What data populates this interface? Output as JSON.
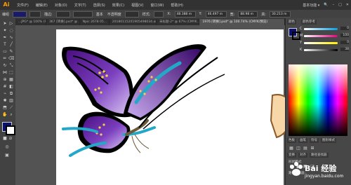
{
  "app": {
    "logo": "Ai"
  },
  "menu": {
    "items": [
      "文件(F)",
      "编辑(E)",
      "对象(O)",
      "文字(T)",
      "选择(S)",
      "效果(C)",
      "视图(V)",
      "窗口(W)",
      "帮助(H)"
    ],
    "right": [
      "基本功能 ▾",
      "🔍"
    ]
  },
  "options": {
    "group_label": "编组",
    "stroke_label": "描边:",
    "basic_label": "基本",
    "opacity_label": "不透明度",
    "style_label": "样式:",
    "x_value": "48.388 m",
    "y_value": "46.497 m",
    "w_value": "88.98 m",
    "h_value": "30.213 m"
  },
  "tabs": [
    "...JPG* @ 100% (R...",
    "367 [转换].psd* @ ...",
    "Npic 2678 05...",
    "20180115201905498034.ai* @ ...",
    "未标题-2* @ 67% (CMYK...)",
    "1976 [转换].psd* @ 100.74% (CMYK/预览)"
  ],
  "toolbar": {
    "fill_color": "#0a1070",
    "stroke_color": "#000000"
  },
  "panel": {
    "color_tab": "颜色",
    "guide_tab": "颜色参考",
    "c_value": "0",
    "m_value": "100",
    "y_value": "0",
    "k_value": "38",
    "swatch_tab": "色板",
    "brush_tab": "画笔",
    "symbol_tab": "符号",
    "graphic_style_tab": "图形样式",
    "layer_tab": "图层",
    "artboard_tab": "画板",
    "transform_tab": "变换",
    "align_tab": "对齐",
    "pathfinder_tab": "路径查找器",
    "shape_mode_label": "形状模式:",
    "pathfinder_label": "路径查找器:"
  },
  "watermark": {
    "text": "Bai 经验",
    "url": "jingyan.baidu.com"
  },
  "colors": {
    "wing_purple": "#5b1b91",
    "wing_light": "#b58be0",
    "teal": "#23a8c8",
    "accent": "#ff9a00"
  }
}
